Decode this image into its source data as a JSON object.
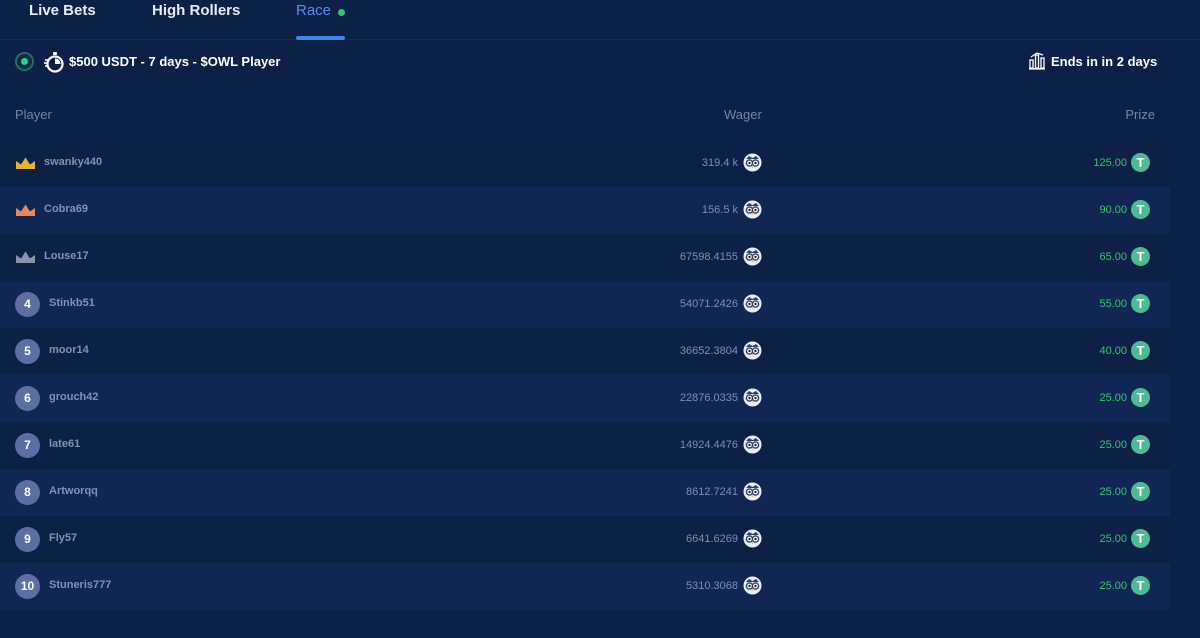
{
  "tabs": {
    "live_bets": "Live Bets",
    "high_rollers": "High Rollers",
    "race": "Race"
  },
  "race": {
    "title": "$500 USDT - 7 days - $OWL Player",
    "ends": "Ends in in 2 days"
  },
  "columns": {
    "player": "Player",
    "wager": "Wager",
    "prize": "Prize"
  },
  "colors": {
    "gold_crown": "#e3b23c",
    "bronze_crown": "#e08a5d",
    "silver_crown": "#8a93a8",
    "accent": "#3c86e8",
    "prize_green": "#34c46e"
  },
  "rows": [
    {
      "rank": "1",
      "player": "swanky440",
      "wager": "319.4 k",
      "prize": "125.00",
      "crown": "gold"
    },
    {
      "rank": "2",
      "player": "Cobra69",
      "wager": "156.5 k",
      "prize": "90.00",
      "crown": "bronze"
    },
    {
      "rank": "3",
      "player": "Louse17",
      "wager": "67598.4155",
      "prize": "65.00",
      "crown": "silver"
    },
    {
      "rank": "4",
      "player": "Stinkb51",
      "wager": "54071.2426",
      "prize": "55.00"
    },
    {
      "rank": "5",
      "player": "moor14",
      "wager": "36652.3804",
      "prize": "40.00"
    },
    {
      "rank": "6",
      "player": "grouch42",
      "wager": "22876.0335",
      "prize": "25.00"
    },
    {
      "rank": "7",
      "player": "late61",
      "wager": "14924.4476",
      "prize": "25.00"
    },
    {
      "rank": "8",
      "player": "Artworqq",
      "wager": "8612.7241",
      "prize": "25.00"
    },
    {
      "rank": "9",
      "player": "Fly57",
      "wager": "6641.6269",
      "prize": "25.00"
    },
    {
      "rank": "10",
      "player": "Stuneris777",
      "wager": "5310.3068",
      "prize": "25.00"
    }
  ]
}
